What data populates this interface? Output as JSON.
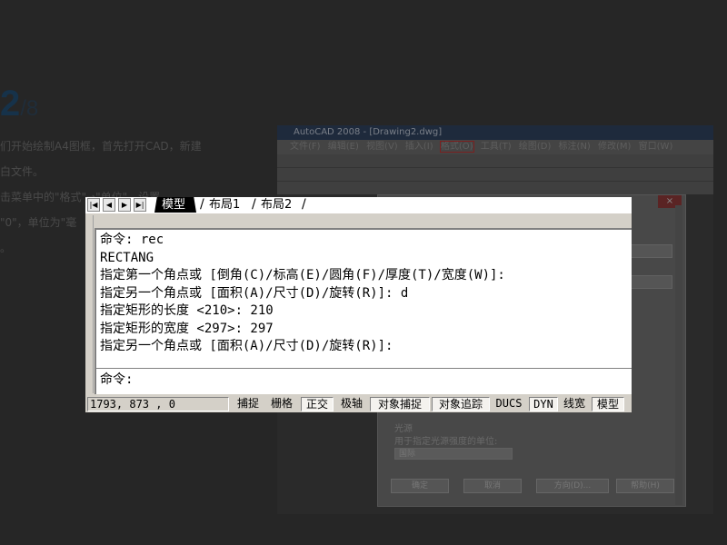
{
  "background_article": {
    "step_current": "2",
    "step_total": "/8",
    "lines": [
      "们开始绘制A4图框，首先打开CAD，新建",
      "白文件。",
      "击菜单中的\"格式\"→\"单位\"，设置",
      "\"0\"，单位为\"毫",
      "。"
    ]
  },
  "background_window": {
    "title": "AutoCAD 2008 - [Drawing2.dwg]",
    "menu_items": [
      "文件(F)",
      "编辑(E)",
      "视图(V)",
      "插入(I)",
      "格式(O)",
      "工具(T)",
      "绘图(D)",
      "标注(N)",
      "修改(M)",
      "窗口(W)"
    ],
    "dialog_close": "×",
    "dialog_section_label": "光源",
    "dialog_section_hint": "用于指定光源强度的单位:",
    "dialog_select_value": "国际",
    "dialog_buttons": [
      "确定",
      "取消",
      "方向(D)...",
      "帮助(H)"
    ]
  },
  "command_window": {
    "nav_buttons": [
      "|◀",
      "◀",
      "▶",
      "▶|"
    ],
    "tabs": [
      "模型",
      "布局1",
      "布局2"
    ],
    "active_tab": "模型",
    "history": [
      "命令: rec",
      "RECTANG",
      "指定第一个角点或 [倒角(C)/标高(E)/圆角(F)/厚度(T)/宽度(W)]:",
      "指定另一个角点或 [面积(A)/尺寸(D)/旋转(R)]: d",
      "指定矩形的长度 <210>: 210",
      "指定矩形的宽度 <297>: 297",
      "指定另一个角点或 [面积(A)/尺寸(D)/旋转(R)]:"
    ],
    "prompt": "命令:"
  },
  "status_bar": {
    "coordinates": "1793, 873 , 0",
    "toggles": [
      {
        "label": "捕捉",
        "on": false
      },
      {
        "label": "栅格",
        "on": false
      },
      {
        "label": "正交",
        "on": true
      },
      {
        "label": "极轴",
        "on": false
      },
      {
        "label": "对象捕捉",
        "on": true
      },
      {
        "label": "对象追踪",
        "on": true
      },
      {
        "label": "DUCS",
        "on": false
      },
      {
        "label": "DYN",
        "on": true
      },
      {
        "label": "线宽",
        "on": false
      },
      {
        "label": "模型",
        "on": true
      }
    ]
  }
}
